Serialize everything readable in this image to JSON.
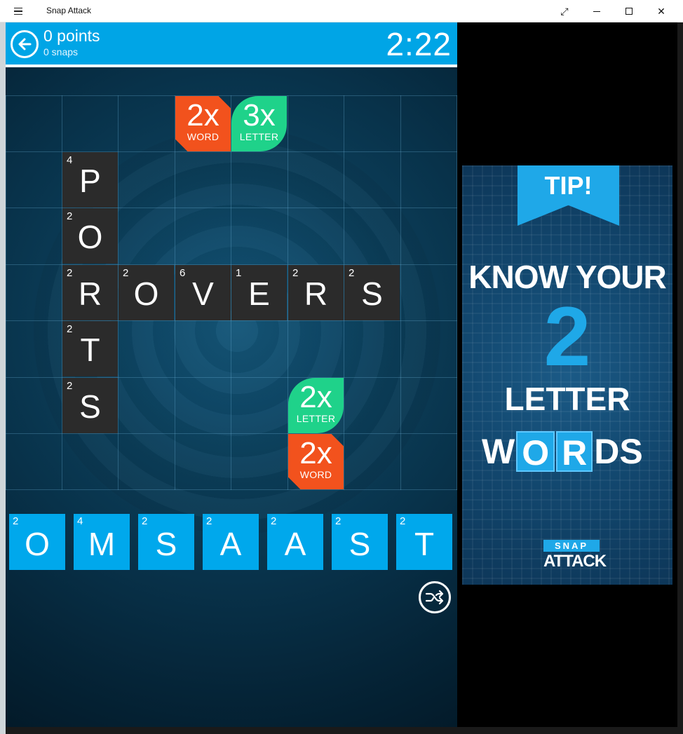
{
  "window": {
    "title": "Snap Attack",
    "menu_icon": "hamburger-icon",
    "controls": [
      "expand-icon",
      "minimize-icon",
      "maximize-icon",
      "close-icon"
    ]
  },
  "header": {
    "points_label": "0 points",
    "snaps_label": "0 snaps",
    "timer": "2:22",
    "accent": "#00a5e6"
  },
  "board": {
    "bonuses": [
      {
        "mult": "2x",
        "kind": "WORD"
      },
      {
        "mult": "3x",
        "kind": "LETTER"
      },
      {
        "mult": "2x",
        "kind": "LETTER"
      },
      {
        "mult": "2x",
        "kind": "WORD"
      }
    ],
    "tiles": [
      {
        "letter": "P",
        "score": "4"
      },
      {
        "letter": "O",
        "score": "2"
      },
      {
        "letter": "R",
        "score": "2"
      },
      {
        "letter": "O",
        "score": "2"
      },
      {
        "letter": "V",
        "score": "6"
      },
      {
        "letter": "E",
        "score": "1"
      },
      {
        "letter": "R",
        "score": "2"
      },
      {
        "letter": "S",
        "score": "2"
      },
      {
        "letter": "T",
        "score": "2"
      },
      {
        "letter": "S",
        "score": "2"
      }
    ]
  },
  "rack": [
    {
      "letter": "O",
      "score": "2"
    },
    {
      "letter": "M",
      "score": "4"
    },
    {
      "letter": "S",
      "score": "2"
    },
    {
      "letter": "A",
      "score": "2"
    },
    {
      "letter": "A",
      "score": "2"
    },
    {
      "letter": "S",
      "score": "2"
    },
    {
      "letter": "T",
      "score": "2"
    }
  ],
  "ad": {
    "tip": "TIP!",
    "line1": "KNOW YOUR",
    "number": "2",
    "line2": "LETTER",
    "line3_parts": [
      "W",
      "O",
      "R",
      "DS"
    ],
    "logo_top": "SNAP",
    "logo_bottom": "ATTACK"
  }
}
